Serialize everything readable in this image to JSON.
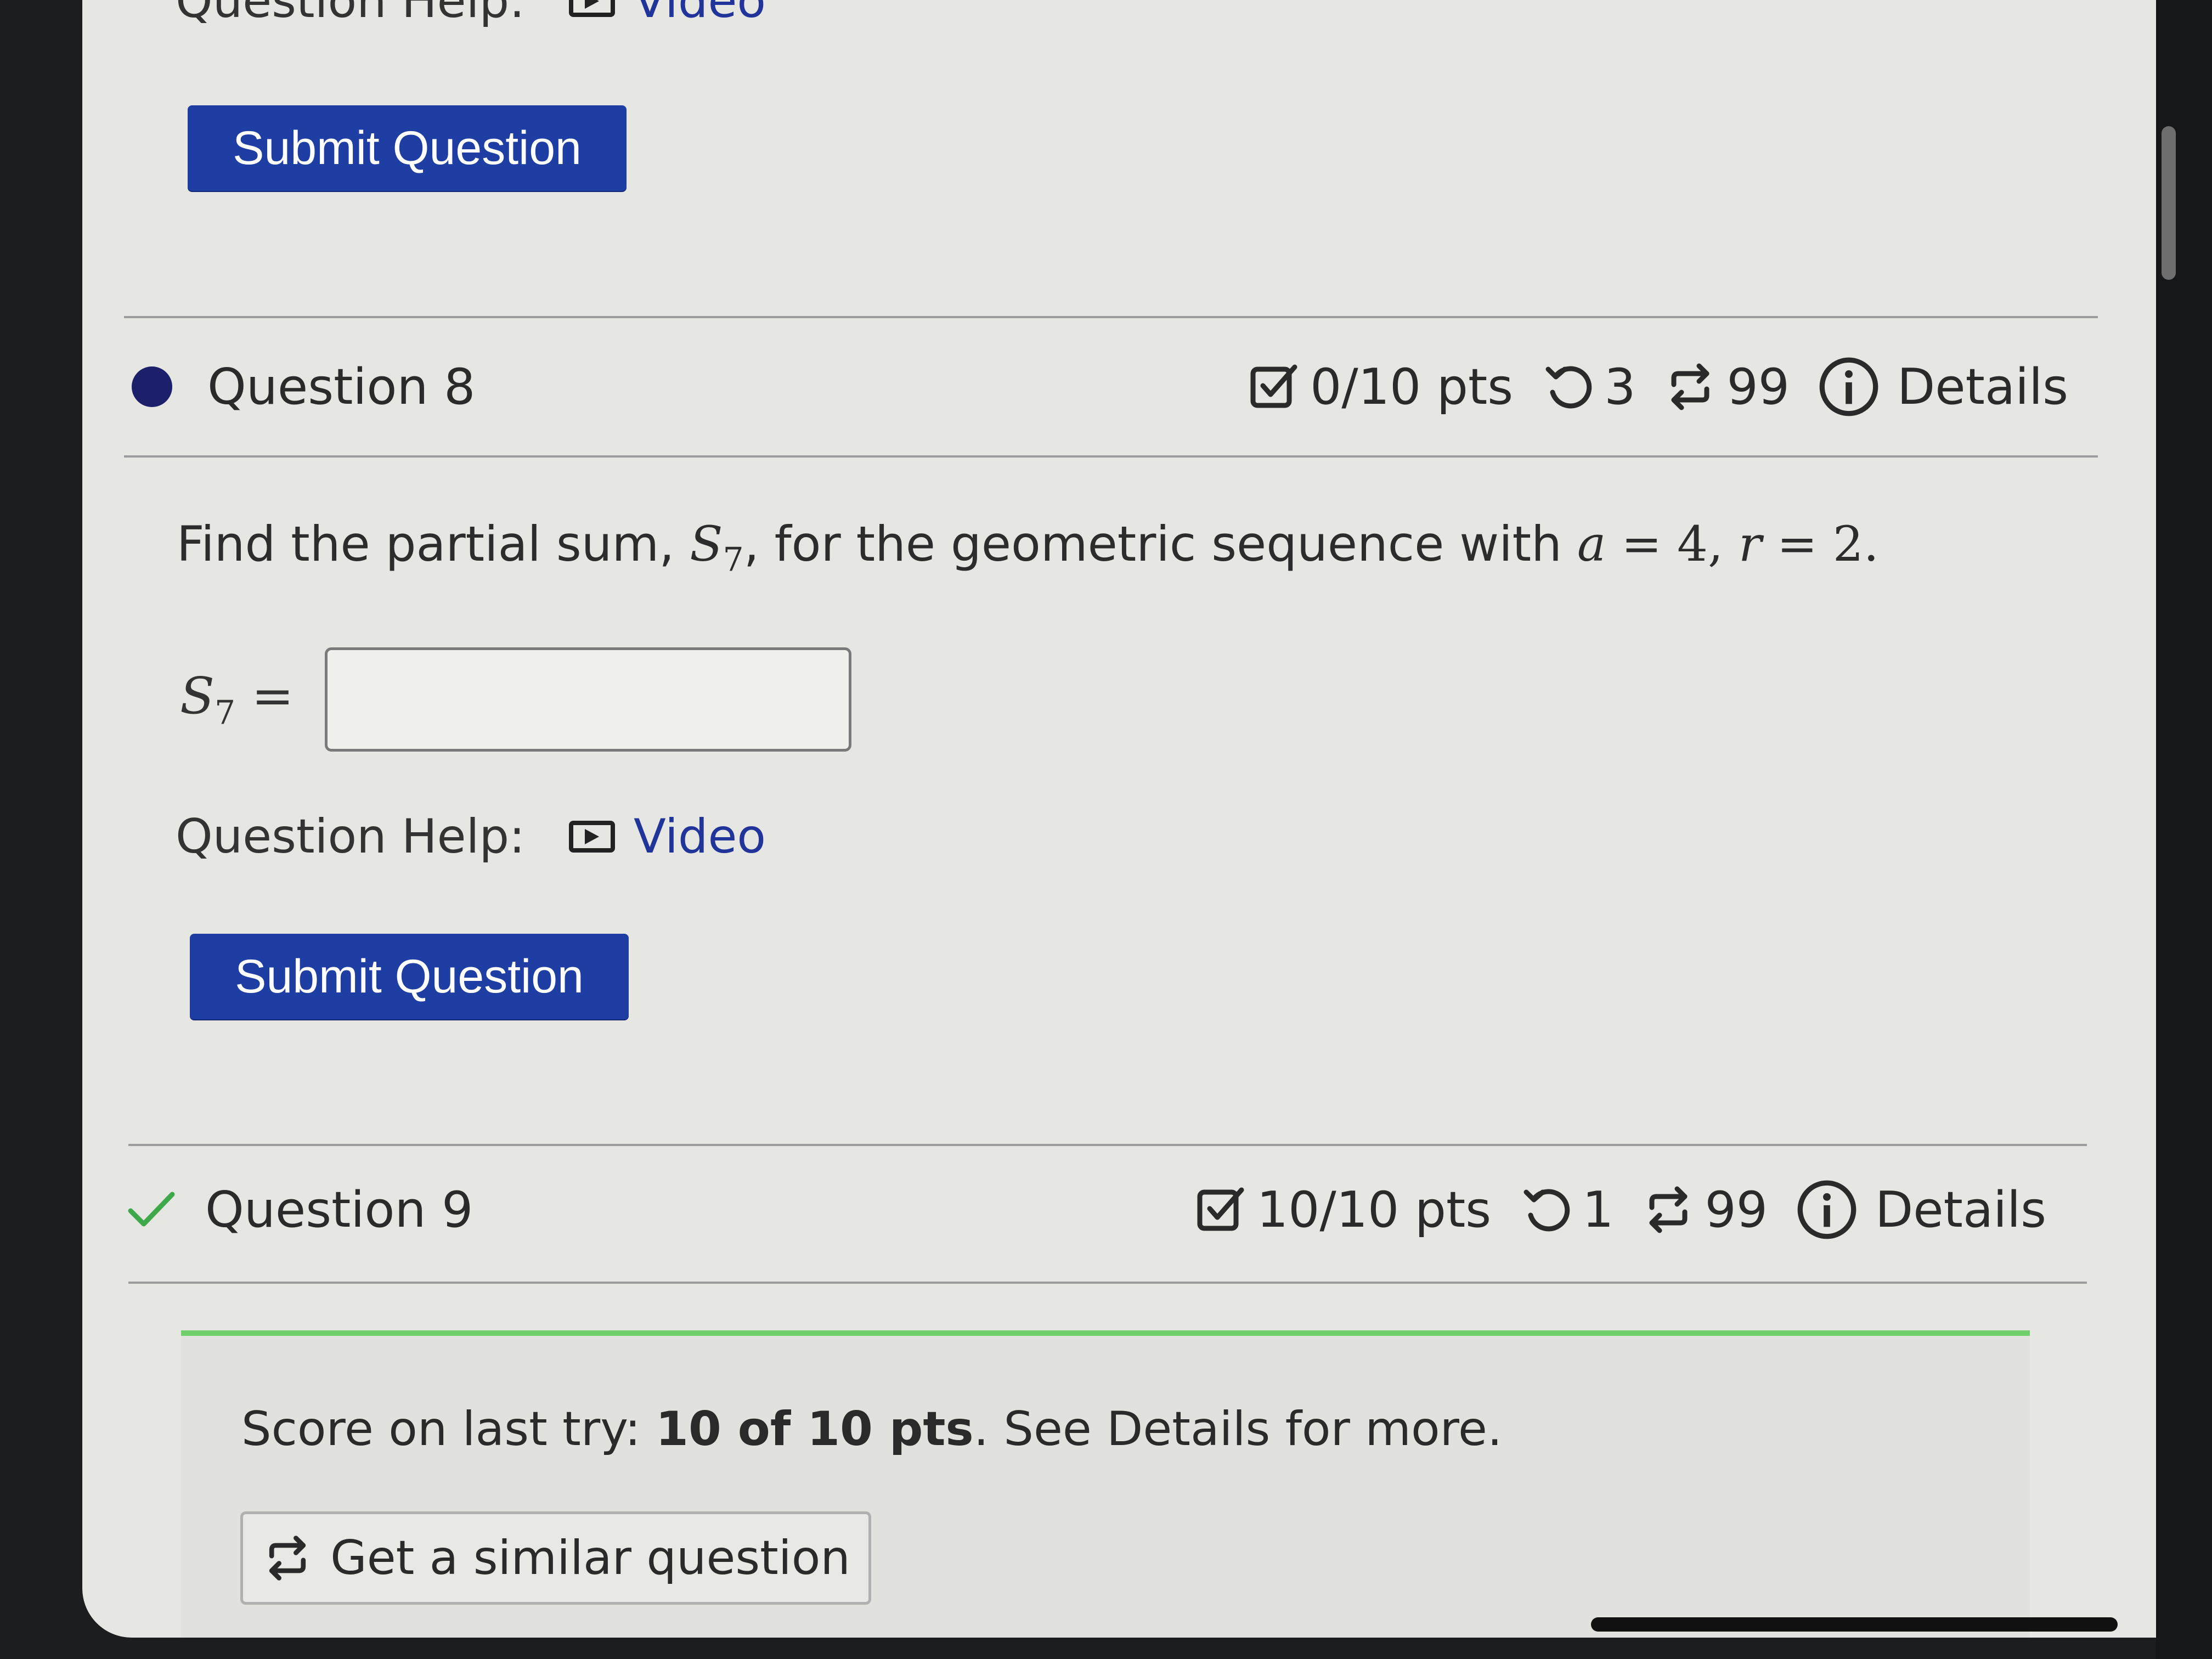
{
  "top_partial": {
    "help_label": "Question Help:",
    "video_label": "Video",
    "submit_label": "Submit Question"
  },
  "question8": {
    "title": "Question 8",
    "points": "0/10 pts",
    "retries": "3",
    "attempts": "99",
    "details_label": "Details",
    "prompt_prefix": "Find the partial sum, ",
    "prompt_sym": "S",
    "prompt_sub": "7",
    "prompt_mid": ", for the geometric sequence with ",
    "prompt_a": "a",
    "prompt_eq1": " = 4, ",
    "prompt_r": "r",
    "prompt_eq2": " = 2.",
    "answer_sym": "S",
    "answer_sub": "7",
    "answer_eq": " =",
    "answer_value": "",
    "help_label": "Question Help:",
    "video_label": "Video",
    "submit_label": "Submit Question"
  },
  "question9": {
    "title": "Question 9",
    "points": "10/10 pts",
    "retries": "1",
    "attempts": "99",
    "details_label": "Details",
    "score_prefix": "Score on last try: ",
    "score_bold": "10 of 10 pts",
    "score_suffix": ". See Details for more.",
    "similar_label": "Get a similar question"
  },
  "colors": {
    "primary_button": "#1f3ea3",
    "link": "#21349a",
    "success": "#6fcf6a",
    "unanswered_dot": "#1c1f6a"
  },
  "icons": {
    "points": "checkbox-icon",
    "retries": "undo-icon",
    "attempts": "repeat-icon",
    "details": "info-circle-icon",
    "video": "play-video-icon",
    "correct": "check-mark-icon"
  }
}
